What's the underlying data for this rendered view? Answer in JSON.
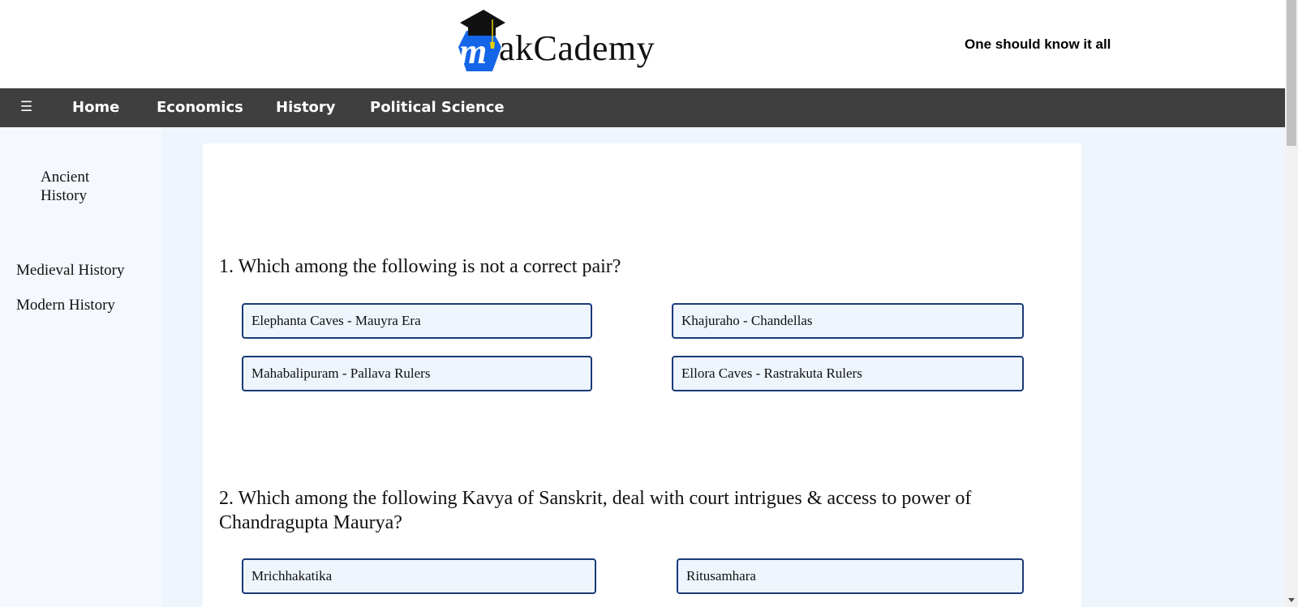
{
  "header": {
    "logo_letter": "m",
    "logo_text": "akCademy",
    "tagline": "One should know it all"
  },
  "nav": {
    "menu_icon": "☰",
    "links": [
      "Home",
      "Economics",
      "History",
      "Political Science"
    ]
  },
  "sidebar": {
    "items": [
      {
        "label": "Ancient History"
      },
      {
        "label": "Medieval History"
      },
      {
        "label": "Modern History"
      }
    ]
  },
  "quiz": {
    "questions": [
      {
        "text": "1. Which among the following is not a correct pair?",
        "options": [
          "Elephanta Caves - Mauyra Era",
          "Khajuraho - Chandellas",
          "Mahabalipuram - Pallava Rulers",
          "Ellora Caves - Rastrakuta Rulers"
        ]
      },
      {
        "text": "2. Which among the following Kavya of Sanskrit, deal with court intrigues & access to power of Chandragupta Maurya?",
        "options": [
          "Mrichhakatika",
          "Ritusamhara"
        ]
      }
    ]
  },
  "colors": {
    "navbar": "#3f3f3f",
    "logo_blue": "#1565e8",
    "option_border": "#1a3a78",
    "option_bg": "#eef5fd",
    "sidebar_bg": "#f5f8fe"
  }
}
